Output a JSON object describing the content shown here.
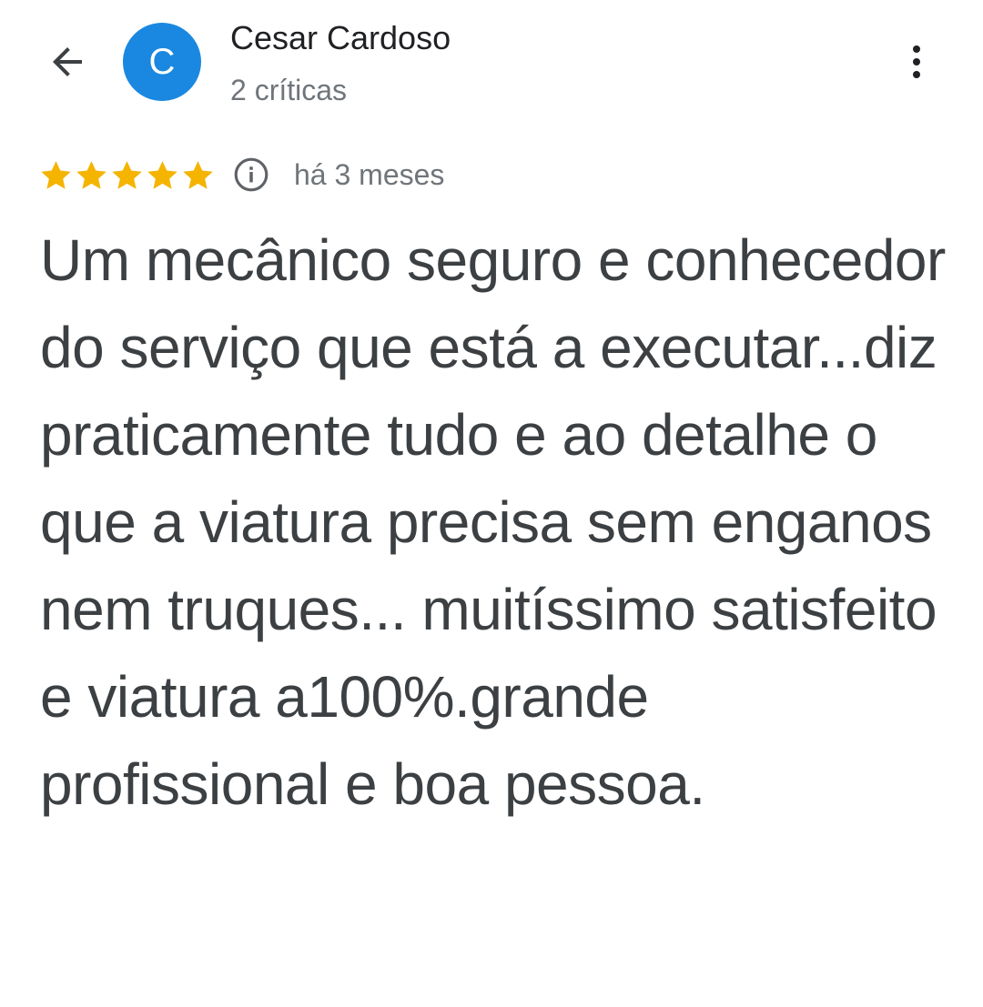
{
  "header": {
    "back_icon": "arrow-back-icon",
    "avatar_letter": "C",
    "avatar_color": "#1a88e0",
    "author_name": "Cesar Cardoso",
    "review_count": "2 críticas",
    "more_icon": "more-vert-icon"
  },
  "review": {
    "rating": 5,
    "rating_max": 5,
    "star_color": "#f4b400",
    "info_icon": "info-icon",
    "date": "há 3 meses",
    "text": "Um mecânico seguro e conhecedor do serviço que está a executar...diz praticamente tudo e ao detalhe o que a viatura precisa sem enganos nem truques... muitíssimo satisfeito e viatura a100%.grande profissional e boa pessoa."
  }
}
